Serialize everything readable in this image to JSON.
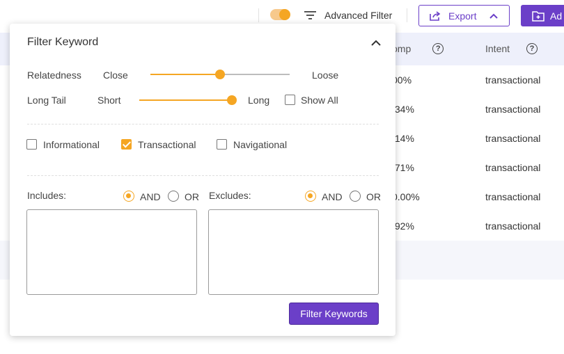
{
  "toolbar": {
    "advanced_filter_label": "Advanced Filter",
    "export_label": "Export",
    "add_label": "Ad"
  },
  "table": {
    "columns": {
      "comp": "omp",
      "intent": "Intent"
    },
    "rows": [
      {
        "comp": "00%",
        "intent": "transactional"
      },
      {
        "comp": ".34%",
        "intent": "transactional"
      },
      {
        "comp": ".14%",
        "intent": "transactional"
      },
      {
        "comp": ".71%",
        "intent": "transactional"
      },
      {
        "comp": "0.00%",
        "intent": "transactional"
      },
      {
        "comp": ".92%",
        "intent": "transactional"
      }
    ]
  },
  "popup": {
    "title": "Filter Keyword",
    "relatedness": {
      "label": "Relatedness",
      "min_label": "Close",
      "max_label": "Loose",
      "value": 0.5
    },
    "long_tail": {
      "label": "Long Tail",
      "min_label": "Short",
      "max_label": "Long",
      "value": 1.0,
      "show_all_label": "Show All",
      "show_all_checked": false
    },
    "intents": [
      {
        "label": "Informational",
        "checked": false
      },
      {
        "label": "Transactional",
        "checked": true
      },
      {
        "label": "Navigational",
        "checked": false
      }
    ],
    "includes": {
      "label": "Includes:",
      "and_label": "AND",
      "or_label": "OR",
      "selected": "AND",
      "value": ""
    },
    "excludes": {
      "label": "Excludes:",
      "and_label": "AND",
      "or_label": "OR",
      "selected": "AND",
      "value": ""
    },
    "filter_button_label": "Filter Keywords"
  },
  "colors": {
    "accent": "#f5a623",
    "brand": "#6b3fc8",
    "header_bg": "#eef0fb"
  }
}
